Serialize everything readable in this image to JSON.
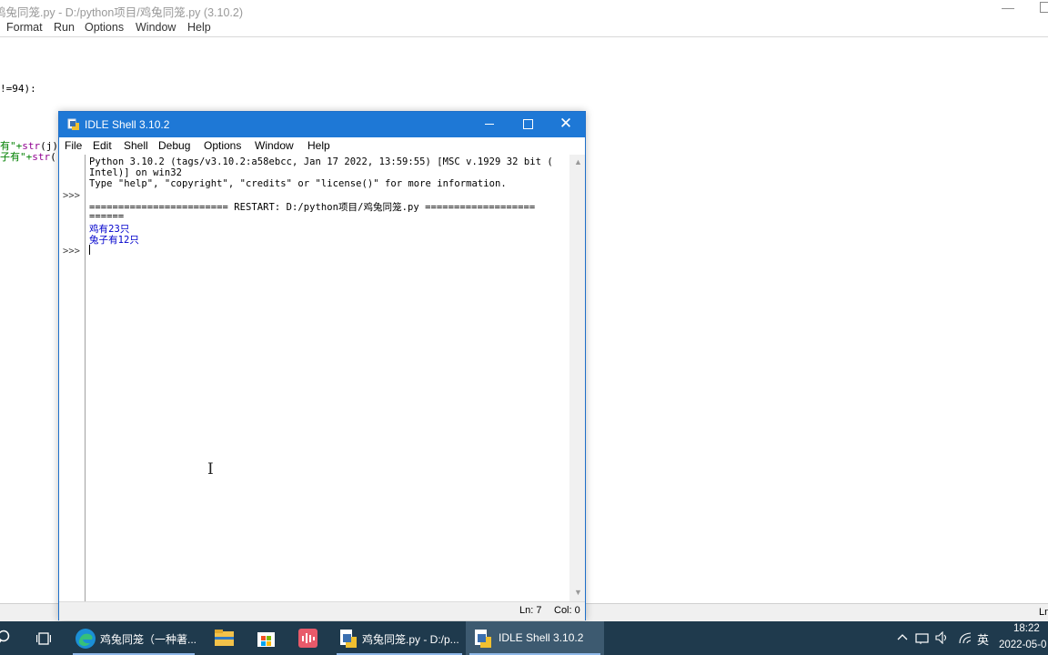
{
  "background_window": {
    "title": "鸡兔同笼.py - D:/python项目/鸡兔同笼.py (3.10.2)",
    "menus": [
      "Format",
      "Run",
      "Options",
      "Window",
      "Help"
    ],
    "code_lines": [
      {
        "text": "!=94):"
      },
      {
        "text_a": "有\"+",
        "text_b": "str",
        "text_c": "(j)"
      },
      {
        "text_a": "子有\"+",
        "text_b": "str",
        "text_c": "("
      }
    ],
    "status_ln": "Ln"
  },
  "shell": {
    "title": "IDLE Shell 3.10.2",
    "menus": [
      "File",
      "Edit",
      "Shell",
      "Debug",
      "Options",
      "Window",
      "Help"
    ],
    "prompt": ">>>",
    "lines": [
      "Python 3.10.2 (tags/v3.10.2:a58ebcc, Jan 17 2022, 13:59:55) [MSC v.1929 32 bit (",
      "Intel)] on win32",
      "Type \"help\", \"copyright\", \"credits\" or \"license()\" for more information.",
      "======================== RESTART: D:/python项目/鸡兔同笼.py ===================",
      "======"
    ],
    "output": [
      "鸡有23只",
      "兔子有12只"
    ],
    "status": {
      "ln": "Ln: 7",
      "col": "Col: 0"
    }
  },
  "taskbar": {
    "apps": [
      {
        "label": "鸡兔同笼（一种著..."
      },
      {
        "label": "鸡兔同笼.py - D:/p..."
      },
      {
        "label": "IDLE Shell 3.10.2"
      }
    ],
    "ime": "英",
    "time": "18:22",
    "date": "2022-05-0"
  },
  "colors": {
    "shell_titlebar": "#1e78d6",
    "taskbar": "#1f3a4d",
    "output_text": "#0000cc"
  }
}
